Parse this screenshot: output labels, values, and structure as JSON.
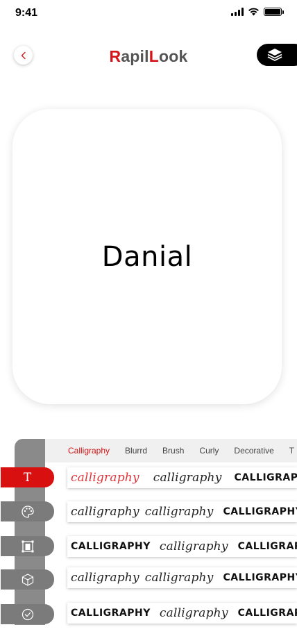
{
  "status_bar": {
    "time": "9:41"
  },
  "header": {
    "title_parts": [
      {
        "text": "R",
        "color": "#d41416"
      },
      {
        "text": "apil",
        "color": "#555555"
      },
      {
        "text": "L",
        "color": "#d41416"
      },
      {
        "text": "ook",
        "color": "#555555"
      }
    ],
    "back_icon": "chevron-left-icon",
    "layers_icon": "layers-icon"
  },
  "canvas": {
    "text": "Danial"
  },
  "font_tabs": {
    "items": [
      "Calligraphy",
      "Blurrd",
      "Brush",
      "Curly",
      "Decorative",
      "T"
    ],
    "active": "Calligraphy"
  },
  "tools": [
    {
      "icon": "text-icon",
      "glyph": "T",
      "active": true
    },
    {
      "icon": "palette-icon",
      "active": false
    },
    {
      "icon": "text-box-icon",
      "active": false
    },
    {
      "icon": "cube-icon",
      "active": false
    },
    {
      "icon": "check-circle-icon",
      "active": false
    }
  ],
  "font_rows": [
    {
      "samples": [
        {
          "text": "calligraphy",
          "style": "script-red"
        },
        {
          "text": "calligraphy",
          "style": "script"
        },
        {
          "text": "CALLIGRAPHY",
          "style": "bold"
        }
      ]
    },
    {
      "samples": [
        {
          "text": "calligraphy",
          "style": "script"
        },
        {
          "text": "calligraphy",
          "style": "script"
        },
        {
          "text": "CALLIGRAPHY",
          "style": "bold"
        }
      ]
    },
    {
      "samples": [
        {
          "text": "CALLIGRAPHY",
          "style": "bold"
        },
        {
          "text": "calligraphy",
          "style": "script"
        },
        {
          "text": "CALLIGRAPHY",
          "style": "bold"
        }
      ]
    },
    {
      "samples": [
        {
          "text": "calligraphy",
          "style": "script"
        },
        {
          "text": "calligraphy",
          "style": "script"
        },
        {
          "text": "CALLIGRAPHY",
          "style": "bold"
        }
      ]
    },
    {
      "samples": [
        {
          "text": "CALLIGRAPHY",
          "style": "bold"
        },
        {
          "text": "calligraphy",
          "style": "script"
        },
        {
          "text": "CALLIGRAPHY",
          "style": "bold"
        }
      ]
    }
  ]
}
